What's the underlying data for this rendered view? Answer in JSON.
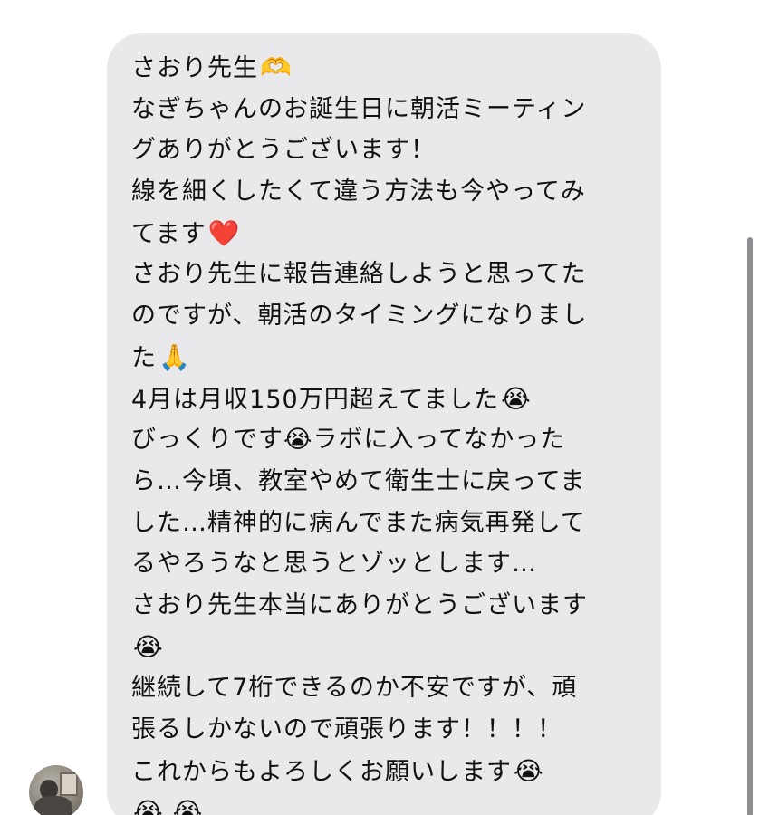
{
  "message": {
    "lines": [
      {
        "text": "さおり先生",
        "emoji": "🫶"
      },
      {
        "text": "なぎちゃんのお誕生日に朝活ミーティン",
        "emoji": ""
      },
      {
        "text": "グありがとうございます！",
        "emoji": ""
      },
      {
        "text": "線を細くしたくて違う方法も今やってみ",
        "emoji": ""
      },
      {
        "text": "てます",
        "emoji": "❤️"
      },
      {
        "text": "さおり先生に報告連絡しようと思ってた",
        "emoji": ""
      },
      {
        "text": "のですが、朝活のタイミングになりまし",
        "emoji": ""
      },
      {
        "text": "た",
        "emoji": "🙏"
      },
      {
        "text": "4月は月収150万円超えてました",
        "emoji": "😭"
      },
      {
        "text": "びっくりです😭ラボに入ってなかった",
        "emoji": ""
      },
      {
        "text": "ら…今頃、教室やめて衛生士に戻ってま",
        "emoji": ""
      },
      {
        "text": "した…精神的に病んでまた病気再発して",
        "emoji": ""
      },
      {
        "text": "るやろうなと思うとゾッとします…",
        "emoji": ""
      },
      {
        "text": "さおり先生本当にありがとうございます",
        "emoji": ""
      },
      {
        "text": "",
        "emoji": "😭"
      },
      {
        "text": "継続して7桁できるのか不安ですが、頑",
        "emoji": ""
      },
      {
        "text": "張るしかないので頑張ります！！！！",
        "emoji": ""
      },
      {
        "text": "これからもよろしくお願いします",
        "emoji": "😭"
      },
      {
        "text": "",
        "emoji": "😭 😭"
      }
    ]
  },
  "colors": {
    "bubble": "#e9e9eb",
    "text": "#111111",
    "background": "#ffffff"
  },
  "icons": {
    "avatar": "user-avatar-photo"
  }
}
